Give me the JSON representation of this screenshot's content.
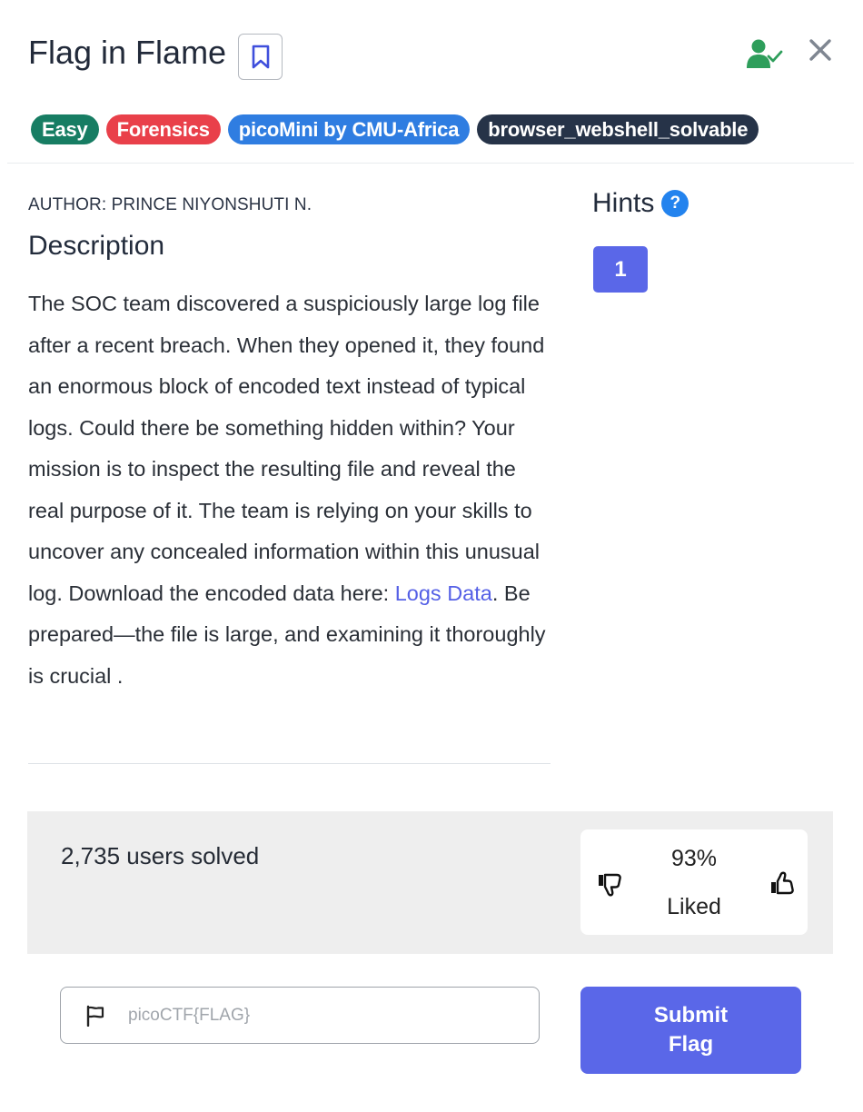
{
  "challenge": {
    "title": "Flag in Flame",
    "tags": [
      {
        "label": "Easy",
        "color": "#177d63"
      },
      {
        "label": "Forensics",
        "color": "#e9404a"
      },
      {
        "label": "picoMini by CMU-Africa",
        "color": "#2f7de1"
      },
      {
        "label": "browser_webshell_solvable",
        "color": "#263348"
      }
    ],
    "author": "AUTHOR: PRINCE NIYONSHUTI N.",
    "description_heading": "Description",
    "description_before_link": "The SOC team discovered a suspiciously large log file after a recent breach. When they opened it, they found an enormous block of encoded text instead of typical logs. Could there be something hidden within? Your mission is to inspect the resulting file and reveal the real purpose of it. The team is relying on your skills to uncover any concealed information within this unusual log. Download the encoded data here: ",
    "description_link": "Logs Data",
    "description_after_link": ". Be prepared—the file is large, and examining it thoroughly is crucial ."
  },
  "hints": {
    "heading": "Hints",
    "help_glyph": "?",
    "items": [
      {
        "label": "1"
      }
    ]
  },
  "stats": {
    "solved_text": "2,735 users solved",
    "liked_percent": "93%",
    "liked_label": "Liked"
  },
  "submit": {
    "placeholder": "picoCTF{FLAG}",
    "button_label": "Submit Flag"
  },
  "icons": {
    "bookmark": "bookmark-icon",
    "solved": "user-check-icon",
    "close": "close-icon",
    "thumb_down": "thumbs-down-icon",
    "thumb_up": "thumbs-up-icon",
    "flag": "flag-icon"
  },
  "colors": {
    "accent": "#5a67e8",
    "solved_green": "#2e9e5b",
    "link": "#5560e6",
    "help_blue": "#2383ee"
  }
}
